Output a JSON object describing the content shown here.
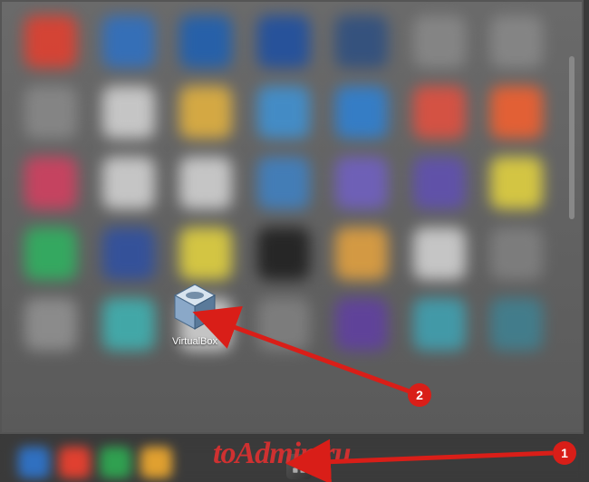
{
  "launchpad": {
    "app_label": "VirtualBox",
    "blur_icons": [
      {
        "bg": "#e04030"
      },
      {
        "bg": "#3070c0"
      },
      {
        "bg": "#2060b0"
      },
      {
        "bg": "#2050a0"
      },
      {
        "bg": "#305080"
      },
      {
        "bg": "#888"
      },
      {
        "bg": "#888"
      },
      {
        "bg": "#888"
      },
      {
        "bg": "#d0d0d0"
      },
      {
        "bg": "#e0b040"
      },
      {
        "bg": "#4090d0"
      },
      {
        "bg": "#3080d0"
      },
      {
        "bg": "#e05040"
      },
      {
        "bg": "#f06030"
      },
      {
        "bg": "#d04060"
      },
      {
        "bg": "#d0d0d0"
      },
      {
        "bg": "#d0d0d0"
      },
      {
        "bg": "#4080c0"
      },
      {
        "bg": "#7060c0"
      },
      {
        "bg": "#6050b0"
      },
      {
        "bg": "#e0d040"
      },
      {
        "bg": "#30b060"
      },
      {
        "bg": "#3050a0"
      },
      {
        "bg": "#e0d040"
      },
      {
        "bg": "#202020"
      },
      {
        "bg": "#e0a040"
      },
      {
        "bg": "#d0d0d0"
      },
      {
        "bg": "#808080"
      },
      {
        "bg": "#909090"
      },
      {
        "bg": "#40b0b0"
      },
      {
        "bg": "#d0d0d0"
      },
      {
        "bg": "#808080"
      },
      {
        "bg": "#6040a0"
      },
      {
        "bg": "#40a0b0"
      },
      {
        "bg": "#408090"
      }
    ]
  },
  "dock": {
    "items": [
      {
        "bg": "#3070c0"
      },
      {
        "bg": "#e04030"
      },
      {
        "bg": "#30a050"
      },
      {
        "bg": "#e0a030"
      }
    ]
  },
  "annotations": {
    "marker1": "1",
    "marker2": "2",
    "watermark": "toAdmin.ru"
  }
}
